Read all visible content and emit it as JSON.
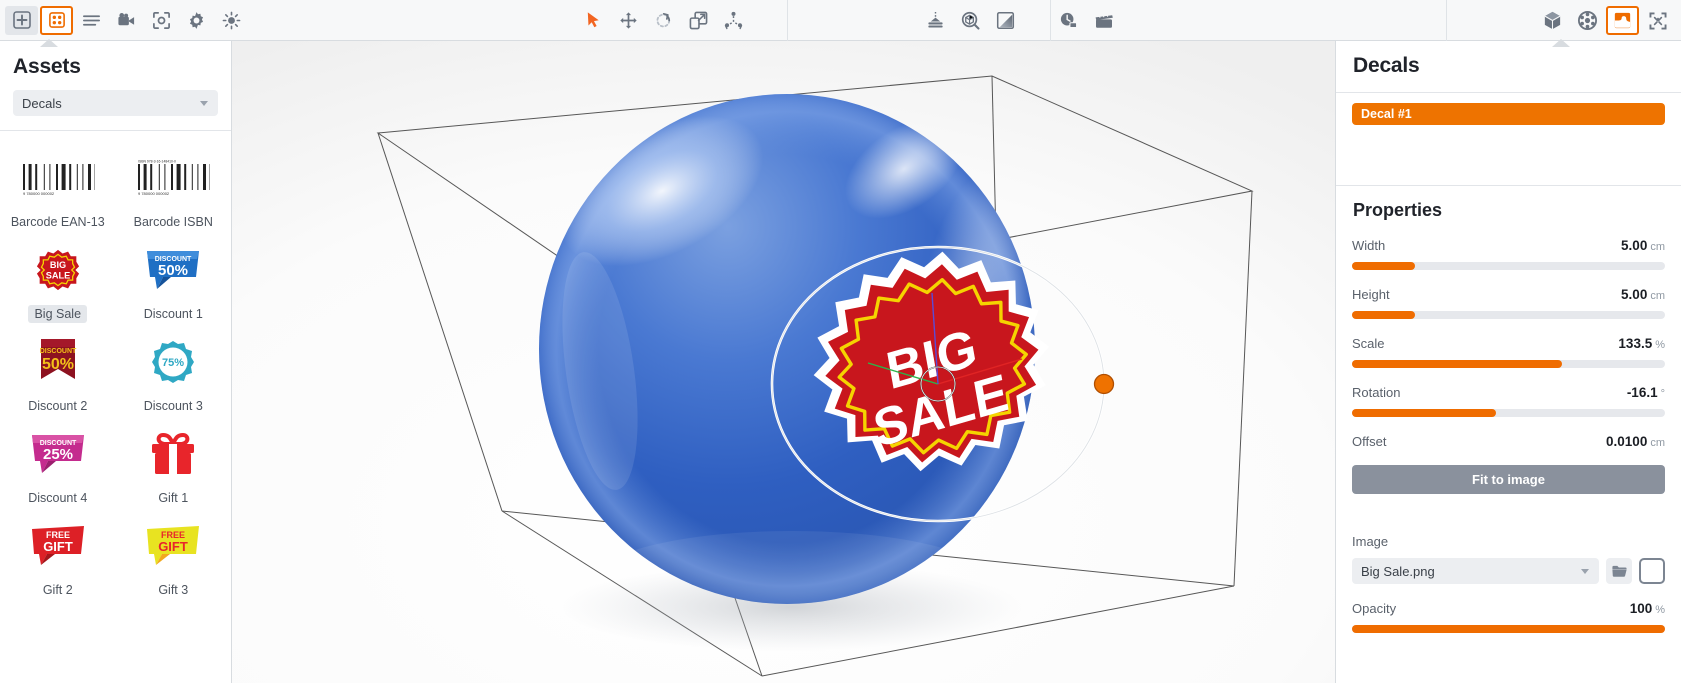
{
  "toolbar": {
    "left_tools": [
      {
        "name": "add-icon",
        "label": "Add",
        "state": "boxed"
      },
      {
        "name": "grid-objects-icon",
        "label": "Objects",
        "state": "active"
      },
      {
        "name": "list-icon",
        "label": "List",
        "state": "normal"
      },
      {
        "name": "camera-icon",
        "label": "Camera",
        "state": "normal"
      },
      {
        "name": "focus-icon",
        "label": "Focus",
        "state": "normal"
      },
      {
        "name": "gear-icon",
        "label": "Settings",
        "state": "normal"
      },
      {
        "name": "sun-icon",
        "label": "Lighting",
        "state": "normal"
      }
    ],
    "mid_tools_a": [
      {
        "name": "select-cursor-icon",
        "label": "Select",
        "state": "active"
      },
      {
        "name": "move-icon",
        "label": "Move",
        "state": "normal"
      },
      {
        "name": "rotate-icon",
        "label": "Rotate",
        "state": "normal"
      },
      {
        "name": "scale-icon",
        "label": "Scale",
        "state": "normal"
      },
      {
        "name": "transform-icon",
        "label": "Transform",
        "state": "normal"
      }
    ],
    "mid_tools_b": [
      {
        "name": "light-table-icon",
        "label": "Studio",
        "state": "normal"
      },
      {
        "name": "environment-icon",
        "label": "Environment",
        "state": "normal"
      },
      {
        "name": "gradient-icon",
        "label": "Backdrop",
        "state": "normal"
      }
    ],
    "mid_tools_c": [
      {
        "name": "history-icon",
        "label": "Snapshots",
        "state": "normal"
      },
      {
        "name": "clapperboard-icon",
        "label": "Animation",
        "state": "normal"
      }
    ],
    "right_tools": [
      {
        "name": "cube-icon",
        "label": "Model",
        "state": "normal"
      },
      {
        "name": "material-ball-icon",
        "label": "Materials",
        "state": "normal"
      },
      {
        "name": "decal-icon",
        "label": "Decals",
        "state": "active"
      },
      {
        "name": "fullscreen-icon",
        "label": "Fullscreen",
        "state": "normal"
      }
    ]
  },
  "assets_panel": {
    "title": "Assets",
    "category": "Decals",
    "items": [
      {
        "label": "Barcode EAN-13",
        "thumb": "barcode",
        "selected": false
      },
      {
        "label": "Barcode ISBN",
        "thumb": "barcode-isbn",
        "selected": false
      },
      {
        "label": "Big Sale",
        "thumb": "big-sale",
        "selected": true
      },
      {
        "label": "Discount 1",
        "thumb": "discount-50-blue",
        "selected": false
      },
      {
        "label": "Discount 2",
        "thumb": "discount-50-red",
        "selected": false
      },
      {
        "label": "Discount 3",
        "thumb": "discount-75-teal",
        "selected": false
      },
      {
        "label": "Discount 4",
        "thumb": "discount-25-pink",
        "selected": false
      },
      {
        "label": "Gift 1",
        "thumb": "gift-box-red",
        "selected": false
      },
      {
        "label": "Gift 2",
        "thumb": "free-gift-red",
        "selected": false
      },
      {
        "label": "Gift 3",
        "thumb": "free-gift-yellow",
        "selected": false
      }
    ]
  },
  "viewport": {
    "decal_text_line1": "BIG",
    "decal_text_line2": "SALE"
  },
  "decals_panel": {
    "title": "Decals",
    "items": [
      {
        "label": "Decal #1",
        "selected": true
      }
    ],
    "properties_title": "Properties",
    "properties": [
      {
        "name": "Width",
        "value": "5.00",
        "unit": "cm",
        "fill_pct": 20
      },
      {
        "name": "Height",
        "value": "5.00",
        "unit": "cm",
        "fill_pct": 20
      },
      {
        "name": "Scale",
        "value": "133.5",
        "unit": "%",
        "fill_pct": 67
      },
      {
        "name": "Rotation",
        "value": "-16.1",
        "unit": "°",
        "fill_pct": 46
      },
      {
        "name": "Offset",
        "value": "0.0100",
        "unit": "cm",
        "fill_pct": null
      }
    ],
    "fit_button_label": "Fit to image",
    "image_label": "Image",
    "image_value": "Big Sale.png",
    "opacity": {
      "name": "Opacity",
      "value": "100",
      "unit": "%",
      "fill_pct": 100
    }
  },
  "colors": {
    "accent_orange": "#ef6c00",
    "decal_chip_orange": "#ee7300",
    "toolbar_bg": "#f7f8f9",
    "icon_grey": "#6b7480",
    "button_grey": "#8a919d",
    "sphere_blue": "#2f62c4"
  }
}
